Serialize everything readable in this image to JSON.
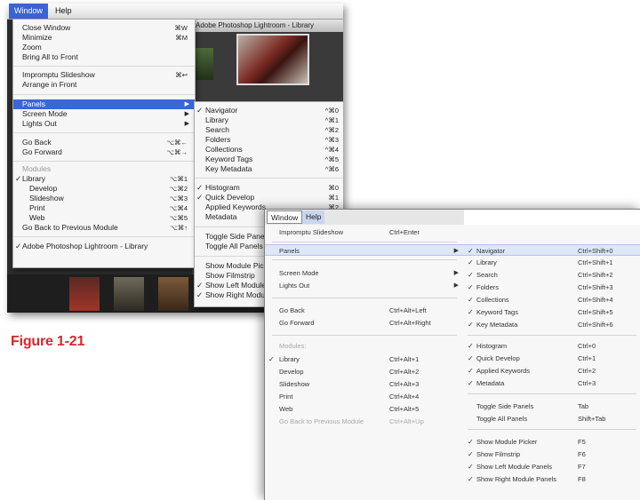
{
  "mac": {
    "menubar": {
      "window": "Window",
      "help": "Help"
    },
    "title": "Adobe Photoshop Lightroom - Library",
    "window_menu": {
      "items": [
        {
          "label": "Close Window",
          "shortcut": "⌘W"
        },
        {
          "label": "Minimize",
          "shortcut": "⌘M"
        },
        {
          "label": "Zoom",
          "shortcut": ""
        },
        {
          "label": "Bring All to Front",
          "shortcut": ""
        },
        {
          "label": "Impromptu Slideshow",
          "shortcut": "⌘↩"
        },
        {
          "label": "Arrange in Front",
          "shortcut": ""
        },
        {
          "label": "Panels",
          "shortcut": ""
        },
        {
          "label": "Screen Mode",
          "shortcut": ""
        },
        {
          "label": "Lights Out",
          "shortcut": ""
        },
        {
          "label": "Go Back",
          "shortcut": "⌥⌘←"
        },
        {
          "label": "Go Forward",
          "shortcut": "⌥⌘→"
        },
        {
          "label": "Modules",
          "shortcut": ""
        },
        {
          "label": "Library",
          "shortcut": "⌥⌘1"
        },
        {
          "label": "Develop",
          "shortcut": "⌥⌘2"
        },
        {
          "label": "Slideshow",
          "shortcut": "⌥⌘3"
        },
        {
          "label": "Print",
          "shortcut": "⌥⌘4"
        },
        {
          "label": "Web",
          "shortcut": "⌥⌘5"
        },
        {
          "label": "Go Back to Previous Module",
          "shortcut": "⌥⌘↑"
        },
        {
          "label": "Adobe Photoshop Lightroom - Library",
          "shortcut": ""
        }
      ]
    },
    "panels_submenu": {
      "items": [
        {
          "label": "Navigator",
          "shortcut": "^⌘0"
        },
        {
          "label": "Library",
          "shortcut": "^⌘1"
        },
        {
          "label": "Search",
          "shortcut": "^⌘2"
        },
        {
          "label": "Folders",
          "shortcut": "^⌘3"
        },
        {
          "label": "Collections",
          "shortcut": "^⌘4"
        },
        {
          "label": "Keyword Tags",
          "shortcut": "^⌘5"
        },
        {
          "label": "Key Metadata",
          "shortcut": "^⌘6"
        },
        {
          "label": "Histogram",
          "shortcut": "⌘0"
        },
        {
          "label": "Quick Develop",
          "shortcut": "⌘1"
        },
        {
          "label": "Applied Keywords",
          "shortcut": "⌘2"
        },
        {
          "label": "Metadata",
          "shortcut": "⌘3"
        },
        {
          "label": "Toggle Side Panels",
          "shortcut": ""
        },
        {
          "label": "Toggle All Panels",
          "shortcut": ""
        },
        {
          "label": "Show Module Picker",
          "shortcut": ""
        },
        {
          "label": "Show Filmstrip",
          "shortcut": ""
        },
        {
          "label": "Show Left Module Panels",
          "shortcut": ""
        },
        {
          "label": "Show Right Module Panels",
          "shortcut": ""
        }
      ]
    }
  },
  "caption": "Figure 1-21",
  "win": {
    "menubar": {
      "window": "Window",
      "help": "Help"
    },
    "window_menu": {
      "items": [
        {
          "label": "Impromptu Slideshow",
          "shortcut": "Ctrl+Enter"
        },
        {
          "label": "Panels",
          "shortcut": ""
        },
        {
          "label": "Screen Mode",
          "shortcut": ""
        },
        {
          "label": "Lights Out",
          "shortcut": ""
        },
        {
          "label": "Go Back",
          "shortcut": "Ctrl+Alt+Left"
        },
        {
          "label": "Go Forward",
          "shortcut": "Ctrl+Alt+Right"
        },
        {
          "label": "Modules:",
          "shortcut": ""
        },
        {
          "label": "Library",
          "shortcut": "Ctrl+Alt+1"
        },
        {
          "label": "Develop",
          "shortcut": "Ctrl+Alt+2"
        },
        {
          "label": "Slideshow",
          "shortcut": "Ctrl+Alt+3"
        },
        {
          "label": "Print",
          "shortcut": "Ctrl+Alt+4"
        },
        {
          "label": "Web",
          "shortcut": "Ctrl+Alt+5"
        },
        {
          "label": "Go Back to Previous Module",
          "shortcut": "Ctrl+Alt+Up"
        }
      ]
    },
    "panels_submenu": {
      "items": [
        {
          "label": "Navigator",
          "shortcut": "Ctrl+Shift+0"
        },
        {
          "label": "Library",
          "shortcut": "Ctrl+Shift+1"
        },
        {
          "label": "Search",
          "shortcut": "Ctrl+Shift+2"
        },
        {
          "label": "Folders",
          "shortcut": "Ctrl+Shift+3"
        },
        {
          "label": "Collections",
          "shortcut": "Ctrl+Shift+4"
        },
        {
          "label": "Keyword Tags",
          "shortcut": "Ctrl+Shift+5"
        },
        {
          "label": "Key Metadata",
          "shortcut": "Ctrl+Shift+6"
        },
        {
          "label": "Histogram",
          "shortcut": "Ctrl+0"
        },
        {
          "label": "Quick Develop",
          "shortcut": "Ctrl+1"
        },
        {
          "label": "Applied Keywords",
          "shortcut": "Ctrl+2"
        },
        {
          "label": "Metadata",
          "shortcut": "Ctrl+3"
        },
        {
          "label": "Toggle Side Panels",
          "shortcut": "Tab"
        },
        {
          "label": "Toggle All Panels",
          "shortcut": "Shift+Tab"
        },
        {
          "label": "Show Module Picker",
          "shortcut": "F5"
        },
        {
          "label": "Show Filmstrip",
          "shortcut": "F6"
        },
        {
          "label": "Show Left Module Panels",
          "shortcut": "F7"
        },
        {
          "label": "Show Right Module Panels",
          "shortcut": "F8"
        }
      ]
    }
  },
  "colors": {
    "mac_highlight": "#3a66d8",
    "caption": "#d8262d",
    "win_highlight": "#dfe7f7"
  },
  "icons": {
    "check": "✓",
    "submenu_arrow": "▶"
  }
}
